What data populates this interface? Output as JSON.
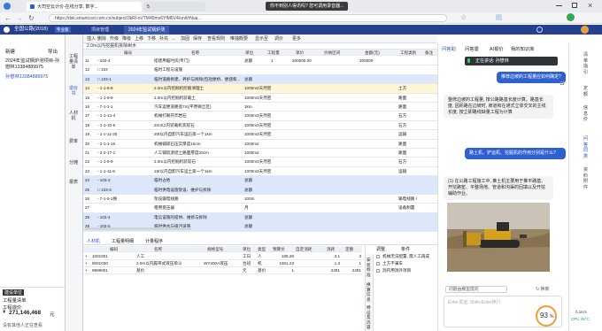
{
  "browser": {
    "tabs": [
      {
        "label": "大司空云计价-在线分享, 数字..."
      },
      {
        "label": "5"
      }
    ],
    "url": "https://dsk.smartcost.com.cn/subject/3kRl-oVTM45mx6YfM6V4/unit/rNua...",
    "share_notice": "你不到别人得讯吗? 您可调用录音器..."
  },
  "app": {
    "project_name": "全国公路(2018)",
    "badge": "专业版",
    "top_tabs": [
      "项目管理",
      "2024年监试锅炉测"
    ],
    "left_controls": [
      "新建",
      "导出"
    ],
    "tree_item_1": "2024年监试钢炉测项目-孙懋林13384889975",
    "tree_item_2": "孙懋林13384889975",
    "vertical_nav": [
      "工程量清单",
      "造价书",
      "人材机",
      "费率",
      "分摊",
      "报表"
    ],
    "left_bottom": {
      "line1": "建设单位",
      "line2": "工程量清单",
      "line3": "工程造价:",
      "amount": "271,146,468",
      "currency": "元",
      "footer": "没有其他人正在查看"
    }
  },
  "toolbar": [
    "插入",
    "删除",
    "升级",
    "降级",
    "上移",
    "下移",
    "补充",
    "...",
    "加固",
    "保存",
    "查看规则",
    "唯独概要",
    "显示至",
    "调价",
    "更多"
  ],
  "breadcrumb": "2.0m以内挖掘机拆除树木",
  "grid": {
    "headers": [
      "",
      "编号",
      "名称",
      "单位",
      "工程量",
      "单价",
      "价格区间",
      "金额(元)",
      "工程类别",
      "备注"
    ],
    "rows": [
      {
        "no": "11",
        "code": "- 102-4",
        "name": "搭建用临时房(专门)",
        "unit": "总额",
        "qty": "1",
        "price": "200000.00",
        "range": "",
        "amount": "200000",
        "cat": "",
        "style": ""
      },
      {
        "no": "12",
        "code": "□ 103",
        "name": "临时工程与设施",
        "unit": "",
        "qty": "",
        "price": "",
        "range": "",
        "amount": "",
        "cat": "",
        "style": ""
      },
      {
        "no": "13",
        "code": "□ 103-1",
        "name": "临时道路修建、养护与拆除(包括便桥、便涵和...",
        "unit": "总额",
        "qty": "",
        "price": "",
        "range": "",
        "amount": "",
        "cat": "",
        "style": "sel"
      },
      {
        "no": "14",
        "code": "- 1-1-8-8",
        "name": "2.0m以内挖掘机挖掘清理土",
        "unit": "1000m3天然密实",
        "qty": "",
        "price": "",
        "range": "",
        "amount": "",
        "cat": "土方",
        "style": "hl"
      },
      {
        "no": "15",
        "code": "- 1-1-9-8",
        "name": "2.0m以内挖掘机装载土",
        "unit": "1000m3天然密实",
        "qty": "",
        "price": "",
        "range": "",
        "amount": "",
        "cat": "路面",
        "style": ""
      },
      {
        "no": "16",
        "code": "- 7-1-1-1",
        "name": "汽车运便道路宽7m(平原微丘区)",
        "unit": "1km",
        "qty": "",
        "price": "",
        "range": "",
        "amount": "",
        "cat": "路面",
        "style": ""
      },
      {
        "no": "17",
        "code": "- 1-1-14-4",
        "name": "机械打眼开炸岩石",
        "unit": "1000m3天然密实",
        "qty": "",
        "price": "",
        "range": "",
        "amount": "",
        "cat": "石方",
        "style": ""
      },
      {
        "no": "18",
        "code": "- 1-1-10-5",
        "name": "2m3以内装载机装软石",
        "unit": "1000m3天然密实",
        "qty": "",
        "price": "",
        "range": "",
        "amount": "",
        "cat": "石方",
        "style": ""
      },
      {
        "no": "19",
        "code": "- 1-1-11-25",
        "name": "20t以内自卸汽车运石第一个1km",
        "unit": "1000m3天然密实",
        "qty": "",
        "price": "",
        "range": "",
        "amount": "",
        "cat": "运输",
        "style": ""
      },
      {
        "no": "20",
        "code": "- 2-1-1-15",
        "name": "机械铺碎石压实厚度15cm",
        "unit": "1000m2",
        "qty": "",
        "price": "",
        "range": "",
        "amount": "",
        "cat": "路面",
        "style": ""
      },
      {
        "no": "21",
        "code": "- 2-2-17-1",
        "name": "人工铺筑泥结土路面厚度20cm",
        "unit": "1000m2",
        "qty": "",
        "price": "",
        "range": "",
        "amount": "",
        "cat": "路面",
        "style": ""
      },
      {
        "no": "22",
        "code": "- 1-1-9-9",
        "name": "2.0m以内挖掘机装软石",
        "unit": "1000m3天然密实",
        "qty": "",
        "price": "",
        "range": "",
        "amount": "",
        "cat": "石方",
        "style": ""
      },
      {
        "no": "23",
        "code": "- 1-1-11-9",
        "name": "15t以内自卸汽车运土第一个1km",
        "unit": "1000m3天然密实",
        "qty": "",
        "price": "",
        "range": "",
        "amount": "",
        "cat": "运输",
        "style": ""
      },
      {
        "no": "24",
        "code": "- 103-2",
        "name": "临时占地",
        "unit": "总额",
        "qty": "",
        "price": "",
        "range": "",
        "amount": "",
        "cat": "",
        "style": "sel"
      },
      {
        "no": "25",
        "code": "□ 103-3",
        "name": "临时供电设施架设、维护与拆除",
        "unit": "总额",
        "qty": "",
        "price": "",
        "range": "",
        "amount": "",
        "cat": "",
        "style": "sel"
      },
      {
        "no": "26",
        "code": "- 7-1-5-1换",
        "name": "架设输电线路",
        "unit": "100m",
        "qty": "",
        "price": "",
        "range": "",
        "amount": "",
        "cat": "输电线路 I",
        "style": ""
      },
      {
        "no": "27",
        "code": "",
        "name": "租用变压器",
        "unit": "月",
        "qty": "",
        "price": "",
        "range": "",
        "amount": "",
        "cat": "设备制置",
        "style": ""
      },
      {
        "no": "28",
        "code": "- 103-4",
        "name": "电信设施的提供、维修与拆除",
        "unit": "总额",
        "qty": "",
        "price": "",
        "range": "",
        "amount": "",
        "cat": "",
        "style": "sel"
      },
      {
        "no": "29",
        "code": "- 103-5",
        "name": "临时供水与排污设施",
        "unit": "总额",
        "qty": "",
        "price": "",
        "range": "",
        "amount": "",
        "cat": "",
        "style": "sel"
      }
    ]
  },
  "bottom": {
    "tabs": [
      "人材机",
      "工程量明细",
      "计量程序"
    ],
    "headers": [
      "",
      "编码",
      "名称",
      "规格型号",
      "单位",
      "类型",
      "预算价",
      "自定消耗",
      "消耗",
      "定额"
    ],
    "rows": [
      {
        "code": "1001001",
        "name": "人工",
        "spec": "",
        "unit": "工日",
        "type": "人",
        "price": "106.28",
        "cons": "3.1",
        "quota": "3"
      },
      {
        "code": "8001030",
        "name": "2.0m以内履带式液压单斗",
        "spec": "WY200A液压",
        "unit": "台班",
        "type": "机",
        "price": "1501.23",
        "cons": "1.3",
        "quota": "1"
      },
      {
        "code": "9999001",
        "name": "基价",
        "spec": "",
        "unit": "元",
        "type": "基价",
        "price": "1",
        "cons": "2281",
        "quota": "2281"
      }
    ],
    "right_headers": [
      "调整",
      "条件"
    ],
    "right_rows": [
      "机械无法配置, 需人工再成",
      "土方不满车",
      "洞内用洞外项目"
    ],
    "right_tabs": [
      "安装标准",
      "换算信息",
      "特征及内容"
    ]
  },
  "chat": {
    "tabs": [
      "问答助",
      "问答置",
      "AI报价",
      "我的知识库"
    ],
    "meeting_label": "正在讲话: 孙懋林",
    "user_msg_1": "推荐边坡的工程量应如何确定?",
    "ai_msg_1": "整修边坡的工程量, 按公路路基长度计算。路基长度, 因而路在边坡时, 坡道和在通式立体交叉的主线长度, 按立即路线缺量工程为计算",
    "user_msg_2": "路土机、铲运机、挖掘机的作用分别是什么?",
    "ai_msg_2": "(1) 在公路工程施工中, 推土机主要用于推平路基、开挖路堑、平整场地、管道和沟渠的回填以及开挖辅助作业。",
    "hint_link": "问题由模型提问",
    "refresh": "换新",
    "input_placeholder": "Enter发送, Shift+Enter换行",
    "percent": "93",
    "percent_unit": "%",
    "speed_up": "0.1K/s",
    "cpu_label": "CPU 49°C"
  },
  "right_sidebar": [
    "清单指引",
    "定额",
    "信息价",
    "问答同类",
    "资料附件"
  ],
  "icons": [
    "back-icon",
    "refresh-icon",
    "star-icon",
    "mic-icon",
    "copy-icon",
    "image-icon",
    "gear-icon"
  ]
}
